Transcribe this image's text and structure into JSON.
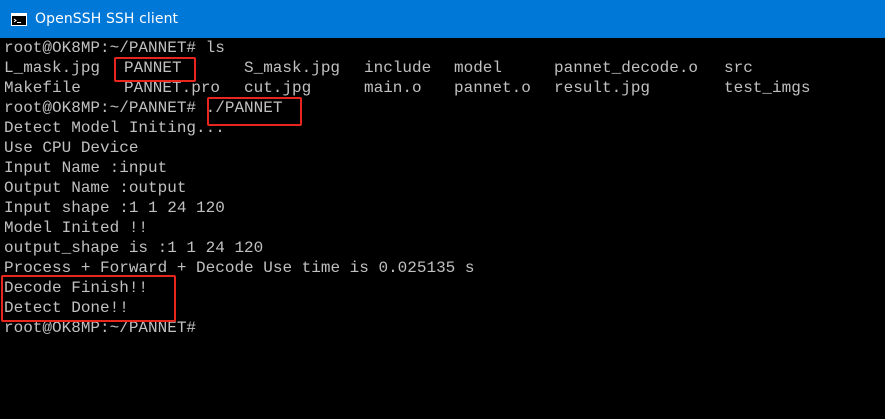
{
  "window": {
    "title": "OpenSSH SSH client",
    "icon": "console-icon",
    "titlebar_color": "#0078d7"
  },
  "colors": {
    "background": "#000000",
    "foreground": "#c0c0c0",
    "highlight_box": "#e8261d"
  },
  "terminal": {
    "prompt1": "root@OK8MP:~/PANNET# ls",
    "ls_row1": [
      "L_mask.jpg",
      "PANNET",
      "S_mask.jpg",
      "include",
      "model",
      "pannet_decode.o",
      "src"
    ],
    "ls_row2": [
      "Makefile",
      "PANNET.pro",
      "cut.jpg",
      "main.o",
      "pannet.o",
      "result.jpg",
      "test_imgs"
    ],
    "prompt2": "root@OK8MP:~/PANNET# ./PANNET",
    "output": [
      "Detect Model Initing...",
      "Use CPU Device",
      "Input Name :input",
      "Output Name :output",
      "Input shape :1 1 24 120",
      "Model Inited !!",
      "output_shape is :1 1 24 120",
      "Process + Forward + Decode Use time is 0.025135 s",
      "Decode Finish!!",
      "Detect Done!!"
    ],
    "prompt3": "root@OK8MP:~/PANNET#"
  }
}
